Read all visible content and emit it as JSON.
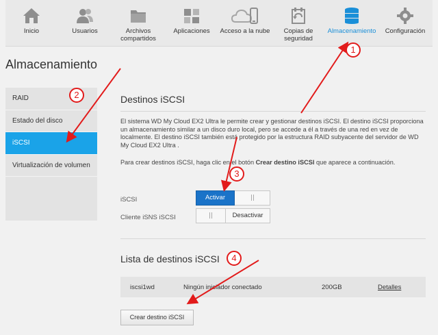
{
  "nav": {
    "items": [
      {
        "label": "Inicio",
        "icon": "home-icon"
      },
      {
        "label": "Usuarios",
        "icon": "users-icon"
      },
      {
        "label": "Archivos compartidos",
        "icon": "folder-icon"
      },
      {
        "label": "Aplicaciones",
        "icon": "apps-icon"
      },
      {
        "label": "Acceso a la nube",
        "icon": "cloud-icon"
      },
      {
        "label": "Copias de seguridad",
        "icon": "backup-icon"
      },
      {
        "label": "Almacenamiento",
        "icon": "storage-icon",
        "active": true
      },
      {
        "label": "Configuración",
        "icon": "gear-icon"
      }
    ],
    "active_color": "#1a8fd8"
  },
  "page_title": "Almacenamiento",
  "sidebar": {
    "items": [
      {
        "label": "RAID"
      },
      {
        "label": "Estado del disco"
      },
      {
        "label": "iSCSI",
        "active": true
      },
      {
        "label": "Virtualización de volumen"
      }
    ],
    "active_color": "#1aa3e8"
  },
  "section": {
    "title": "Destinos iSCSI",
    "description": "El sistema WD My Cloud EX2 Ultra le permite crear y gestionar destinos iSCSI. El destino iSCSI proporciona un almacenamiento similar a un disco duro local, pero se accede a él a través de una red en vez de localmente. El destino iSCSI también está protegido por la estructura RAID subyacente del servidor de WD My Cloud EX2 Ultra .",
    "instruction_prefix": "Para crear destinos iSCSI, haga clic en el botón ",
    "instruction_bold": "Crear destino iSCSI",
    "instruction_suffix": " que aparece a continuación."
  },
  "settings": {
    "iscsi": {
      "label": "iSCSI",
      "on_label": "Activar",
      "state": "on"
    },
    "isns": {
      "label": "Cliente iSNS iSCSI",
      "off_label": "Desactivar",
      "state": "off"
    }
  },
  "list": {
    "title": "Lista de destinos iSCSI",
    "rows": [
      {
        "name": "iscsi1wd",
        "status": "Ningún iniciador conectado",
        "size": "200GB",
        "details": "Detalles"
      }
    ],
    "create_button": "Crear destino iSCSI"
  },
  "annotations": {
    "badges": [
      "1",
      "2",
      "3",
      "4"
    ],
    "color": "#e21b1b"
  }
}
